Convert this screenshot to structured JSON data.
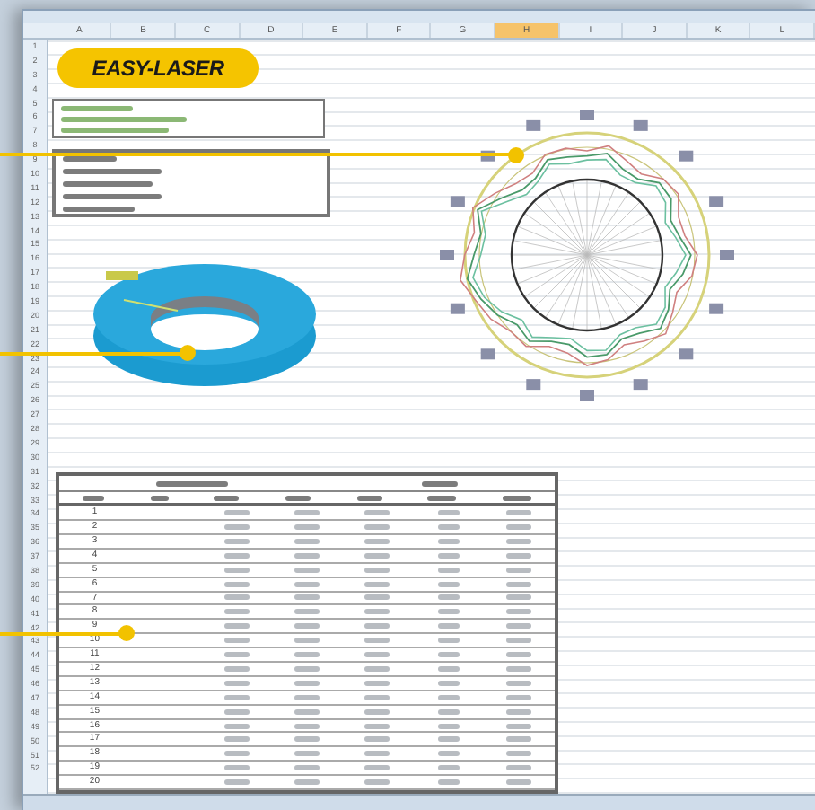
{
  "logo": {
    "text": "EASY-LASER"
  },
  "columns": [
    "A",
    "B",
    "C",
    "D",
    "E",
    "F",
    "G",
    "H",
    "I",
    "J",
    "K",
    "L"
  ],
  "row_numbers": [
    "1",
    "2",
    "3",
    "4",
    "5",
    "6",
    "7",
    "8",
    "9",
    "10",
    "11",
    "12",
    "13",
    "14",
    "15",
    "16",
    "17",
    "18",
    "19",
    "20",
    "21",
    "22",
    "23",
    "24",
    "25",
    "26",
    "27",
    "28",
    "29",
    "30",
    "31",
    "32",
    "33",
    "34",
    "35",
    "36",
    "37",
    "38",
    "39",
    "40",
    "41",
    "42",
    "43",
    "44",
    "45",
    "46",
    "47",
    "48",
    "49",
    "50",
    "51",
    "52"
  ],
  "table": {
    "first_column": [
      "1",
      "2",
      "3",
      "4",
      "5",
      "6",
      "7",
      "8",
      "9",
      "10",
      "11",
      "12",
      "13",
      "14",
      "15",
      "16",
      "17",
      "18",
      "19",
      "20"
    ]
  }
}
